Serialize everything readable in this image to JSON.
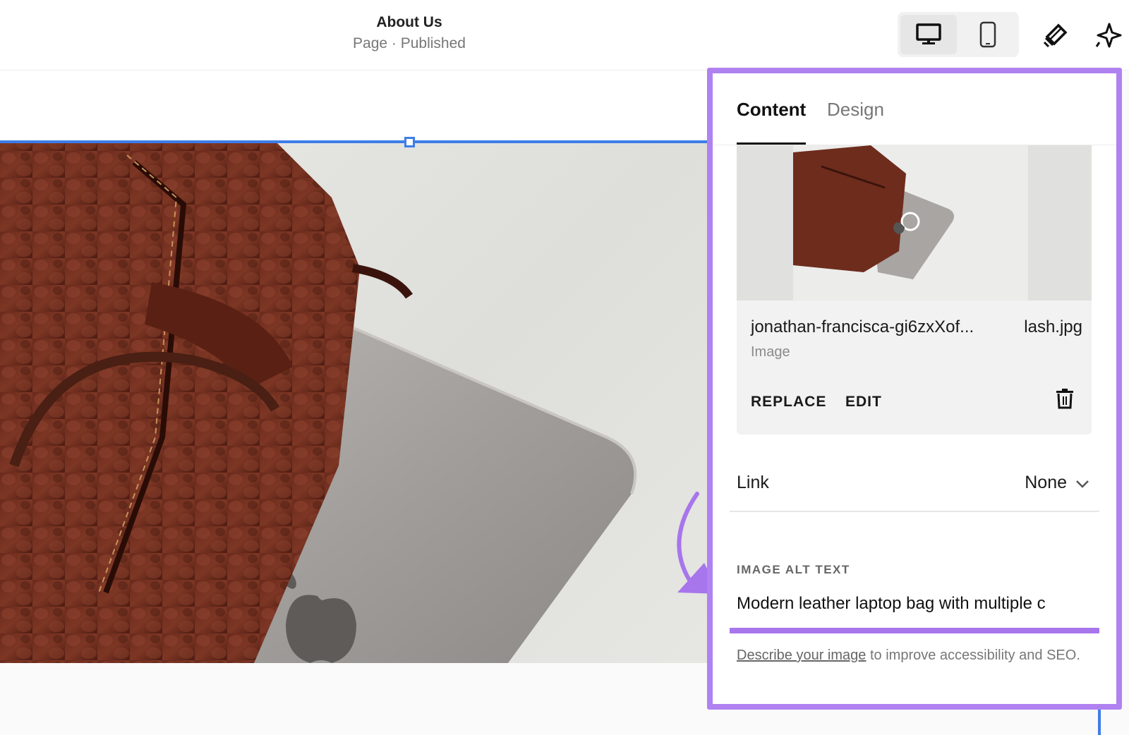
{
  "topbar": {
    "title": "About Us",
    "subtitle": "Page · Published",
    "icons": [
      "desktop-icon",
      "mobile-icon",
      "brush-icon",
      "sparkle-icon"
    ]
  },
  "panel": {
    "tabs": [
      {
        "label": "Content",
        "active": true
      },
      {
        "label": "Design",
        "active": false
      }
    ],
    "image_card": {
      "filename_start": "jonathan-francisca-gi6zxXof...",
      "filename_end": "lash.jpg",
      "type": "Image",
      "replace_label": "REPLACE",
      "edit_label": "EDIT"
    },
    "link": {
      "label": "Link",
      "value": "None"
    },
    "alt_text": {
      "label": "IMAGE ALT TEXT",
      "value": "Modern leather laptop bag with multiple c",
      "help_link": "Describe your image",
      "help_rest": " to improve accessibility and SEO."
    }
  },
  "colors": {
    "accent_purple": "#b081f0",
    "selection_blue": "#3d7ee8"
  }
}
